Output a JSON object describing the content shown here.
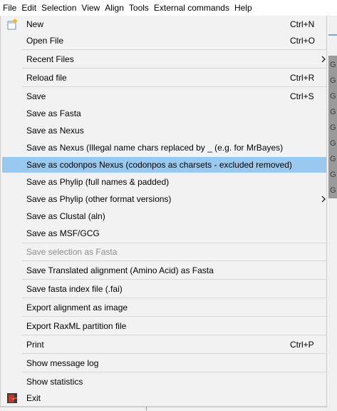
{
  "menubar": {
    "items": [
      "File",
      "Edit",
      "Selection",
      "View",
      "Align",
      "Tools",
      "External commands",
      "Help"
    ]
  },
  "background_window": {
    "row_glyph": "G"
  },
  "file_menu": {
    "new": {
      "label": "New",
      "shortcut": "Ctrl+N"
    },
    "open_file": {
      "label": "Open File",
      "shortcut": "Ctrl+O"
    },
    "recent_files": {
      "label": "Recent Files"
    },
    "reload_file": {
      "label": "Reload file",
      "shortcut": "Ctrl+R"
    },
    "save": {
      "label": "Save",
      "shortcut": "Ctrl+S"
    },
    "save_as_fasta": {
      "label": "Save as Fasta"
    },
    "save_as_nexus": {
      "label": "Save as Nexus"
    },
    "save_as_nexus_mrbayes": {
      "label": "Save as Nexus (Illegal name chars replaced by _ (e.g. for MrBayes)"
    },
    "save_as_codonpos_nexus": {
      "label": "Save as codonpos Nexus (codonpos as charsets - excluded removed)",
      "highlighted": true
    },
    "save_as_phylip_full": {
      "label": "Save as Phylip (full names & padded)"
    },
    "save_as_phylip_other": {
      "label": "Save as Phylip (other format versions)"
    },
    "save_as_clustal": {
      "label": "Save as Clustal (aln)"
    },
    "save_as_msf": {
      "label": "Save as MSF/GCG"
    },
    "save_selection_as_fasta": {
      "label": "Save selection as Fasta",
      "disabled": true
    },
    "save_translated": {
      "label": "Save Translated alignment (Amino Acid) as Fasta"
    },
    "save_fasta_index": {
      "label": "Save fasta index file (.fai)"
    },
    "export_image": {
      "label": "Export alignment as image"
    },
    "export_raxml": {
      "label": "Export RaxML partition file"
    },
    "print": {
      "label": "Print",
      "shortcut": "Ctrl+P"
    },
    "show_message_log": {
      "label": "Show message log"
    },
    "show_statistics": {
      "label": "Show statistics"
    },
    "exit": {
      "label": "Exit"
    }
  },
  "colors": {
    "highlight": "#99c9ef",
    "menu_bg": "#f2f2f2",
    "disabled_text": "#8d8d8d"
  }
}
